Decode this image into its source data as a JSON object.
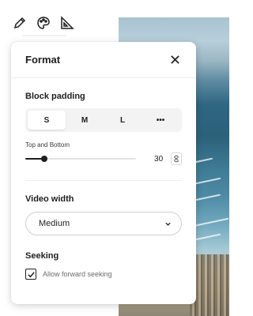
{
  "toolbar": {
    "tools": [
      {
        "icon": "pencil-icon"
      },
      {
        "icon": "palette-icon"
      },
      {
        "icon": "set-square-icon"
      }
    ]
  },
  "panel": {
    "title": "Format",
    "close_icon": "close-icon",
    "block_padding": {
      "title": "Block padding",
      "options": [
        "S",
        "M",
        "L",
        "•••"
      ],
      "active_option": "S",
      "slider": {
        "label": "Top and Bottom",
        "value": "30",
        "fraction": 0.17
      }
    },
    "video_width": {
      "title": "Video width",
      "selected": "Medium"
    },
    "seeking": {
      "title": "Seeking",
      "checkbox_label": "Allow forward seeking",
      "checked": true
    }
  }
}
